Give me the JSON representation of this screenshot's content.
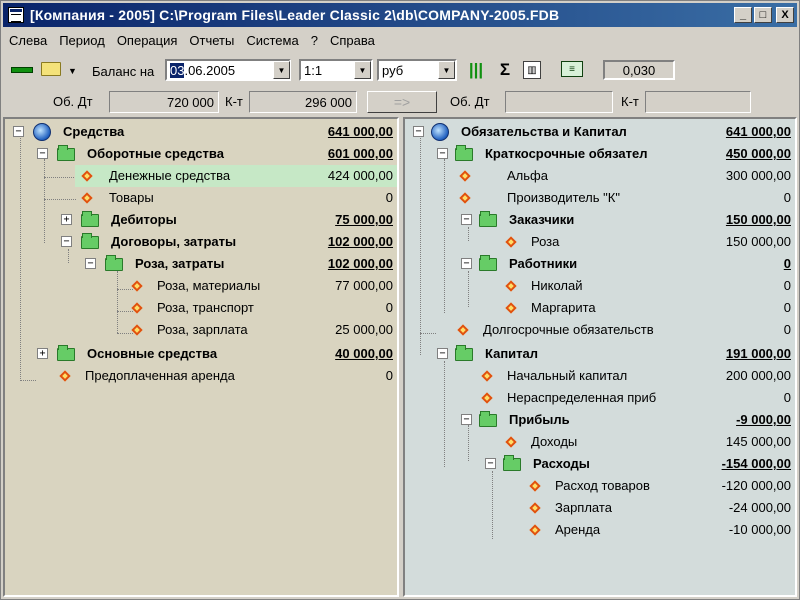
{
  "window": {
    "title": "[Компания - 2005] C:\\Program Files\\Leader Classic 2\\db\\COMPANY-2005.FDB",
    "buttons": {
      "minimize": "_",
      "maximize": "□",
      "close": "X"
    }
  },
  "menu": [
    "Слева",
    "Период",
    "Операция",
    "Отчеты",
    "Система",
    "?",
    "Справа"
  ],
  "toolbar": {
    "balance_label": "Баланс на",
    "date_selected": "03",
    "date_rest": ".06.2005",
    "scale": "1:1",
    "currency": "руб",
    "value_box": "0,030"
  },
  "balance_row": {
    "left_dt_label": "Об. Дт",
    "left_dt_value": "720 000",
    "left_kt_label": "К-т",
    "left_kt_value": "296 000",
    "transfer_symbol": "=>",
    "right_dt_label": "Об. Дт",
    "right_dt_value": "",
    "right_kt_label": "К-т",
    "right_kt_value": ""
  },
  "left_tree": [
    {
      "label": "Средства",
      "amount": "641 000,00"
    },
    {
      "label": "Оборотные средства",
      "amount": "601 000,00"
    },
    {
      "label": "Денежные средства",
      "amount": "424 000,00"
    },
    {
      "label": "Товары",
      "amount": "0"
    },
    {
      "label": "Дебиторы",
      "amount": "75 000,00"
    },
    {
      "label": "Договоры, затраты",
      "amount": "102 000,00"
    },
    {
      "label": "Роза, затраты",
      "amount": "102 000,00"
    },
    {
      "label": "Роза, материалы",
      "amount": "77 000,00"
    },
    {
      "label": "Роза, транспорт",
      "amount": "0"
    },
    {
      "label": "Роза, зарплата",
      "amount": "25 000,00"
    },
    {
      "label": "Основные средства",
      "amount": "40 000,00"
    },
    {
      "label": "Предоплаченная аренда",
      "amount": "0"
    }
  ],
  "right_tree": [
    {
      "label": "Обязательства и Капитал",
      "amount": "641 000,00"
    },
    {
      "label": "Краткосрочные обязател",
      "amount": "450 000,00"
    },
    {
      "label": "Альфа",
      "amount": "300 000,00"
    },
    {
      "label": "Производитель \"К\"",
      "amount": "0"
    },
    {
      "label": "Заказчики",
      "amount": "150 000,00"
    },
    {
      "label": "Роза",
      "amount": "150 000,00"
    },
    {
      "label": "Работники",
      "amount": "0"
    },
    {
      "label": "Николай",
      "amount": "0"
    },
    {
      "label": "Маргарита",
      "amount": "0"
    },
    {
      "label": "Долгосрочные обязательств",
      "amount": "0"
    },
    {
      "label": "Капитал",
      "amount": "191 000,00"
    },
    {
      "label": "Начальный капитал",
      "amount": "200 000,00"
    },
    {
      "label": "Нераспределенная приб",
      "amount": "0"
    },
    {
      "label": "Прибыль",
      "amount": "-9 000,00"
    },
    {
      "label": "Доходы",
      "amount": "145 000,00"
    },
    {
      "label": "Расходы",
      "amount": "-154 000,00"
    },
    {
      "label": "Расход товаров",
      "amount": "-120 000,00"
    },
    {
      "label": "Зарплата",
      "amount": "-24 000,00"
    },
    {
      "label": "Аренда",
      "amount": "-10 000,00"
    }
  ],
  "colors": {
    "left_panel_bg": "#d9d4c0",
    "right_panel_bg": "#d3dcdb",
    "highlight_row": "#c6e8c6",
    "folder_green": "#66cc66",
    "diamond_border": "#e05010",
    "titlebar": "#0a246a"
  },
  "icons": {
    "root": "globe-icon",
    "group": "folder-icon",
    "leaf": "diamond-icon",
    "expand": "plus-box-icon",
    "collapse": "minus-box-icon"
  }
}
